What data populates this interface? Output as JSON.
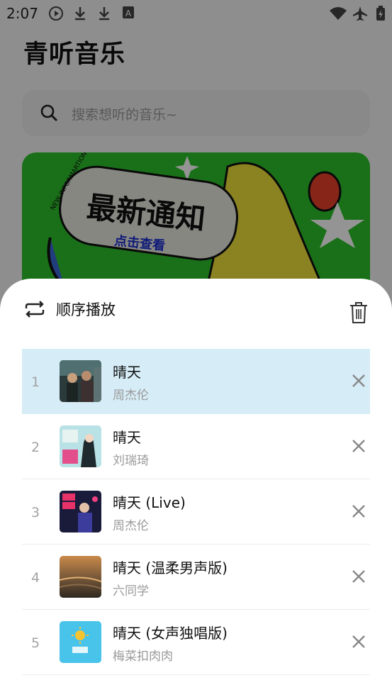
{
  "status": {
    "time": "2:07"
  },
  "app": {
    "title": "青听音乐",
    "search_placeholder": "搜索想听的音乐~"
  },
  "banner": {
    "small_text": "NEW INFORMARTION",
    "headline": "最新通知",
    "cta": "点击查看"
  },
  "sheet": {
    "mode_label": "顺序播放",
    "items": [
      {
        "index": "1",
        "title": "晴天",
        "artist": "周杰伦"
      },
      {
        "index": "2",
        "title": "晴天",
        "artist": "刘瑞琦"
      },
      {
        "index": "3",
        "title": "晴天 (Live)",
        "artist": "周杰伦"
      },
      {
        "index": "4",
        "title": "晴天 (温柔男声版)",
        "artist": "六同学"
      },
      {
        "index": "5",
        "title": "晴天 (女声独唱版)",
        "artist": "梅菜扣肉肉"
      }
    ]
  },
  "colors": {
    "active_row": "#d6ecf6",
    "banner_green": "#2dc12b",
    "sheet_bg": "#ffffff"
  }
}
